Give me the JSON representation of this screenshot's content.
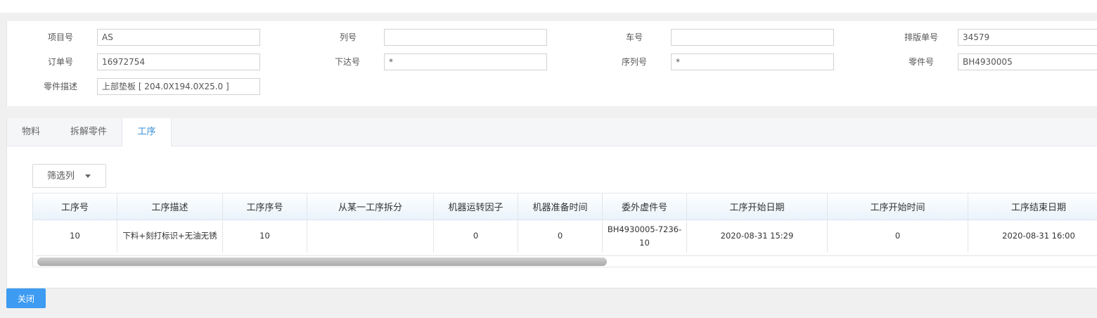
{
  "form": {
    "project_no": {
      "label": "项目号",
      "value": "AS"
    },
    "column_no": {
      "label": "列号",
      "value": ""
    },
    "car_no": {
      "label": "车号",
      "value": ""
    },
    "layout_no": {
      "label": "排版单号",
      "value": "34579"
    },
    "order_no": {
      "label": "订单号",
      "value": "16972754"
    },
    "release_no": {
      "label": "下达号",
      "value": "*"
    },
    "serial_no": {
      "label": "序列号",
      "value": "*"
    },
    "part_no": {
      "label": "零件号",
      "value": "BH4930005"
    },
    "part_desc": {
      "label": "零件描述",
      "value": "上部垫板 [ 204.0X194.0X25.0 ]"
    }
  },
  "tabs": [
    "物料",
    "拆解零件",
    "工序"
  ],
  "active_tab": "工序",
  "filter_button": {
    "label": "筛选列",
    "icon": "caret-down-icon"
  },
  "table": {
    "columns": [
      "工序号",
      "工序描述",
      "工序序号",
      "从某一工序拆分",
      "机器运转因子",
      "机器准备时间",
      "委外虚件号",
      "工序开始日期",
      "工序开始时间",
      "工序结束日期"
    ],
    "rows": [
      [
        "10",
        "下料+刻打标识+无油无锈",
        "10",
        "",
        "0",
        "0",
        "BH4930005-7236-10",
        "2020-08-31 15:29",
        "0",
        "2020-08-31 16:00"
      ]
    ]
  },
  "close_button": {
    "label": "关闭"
  },
  "colors": {
    "accent": "#3d9bf2",
    "tab_active": "#3b8fd6",
    "header_gradient_end": "#e9f3fb"
  }
}
